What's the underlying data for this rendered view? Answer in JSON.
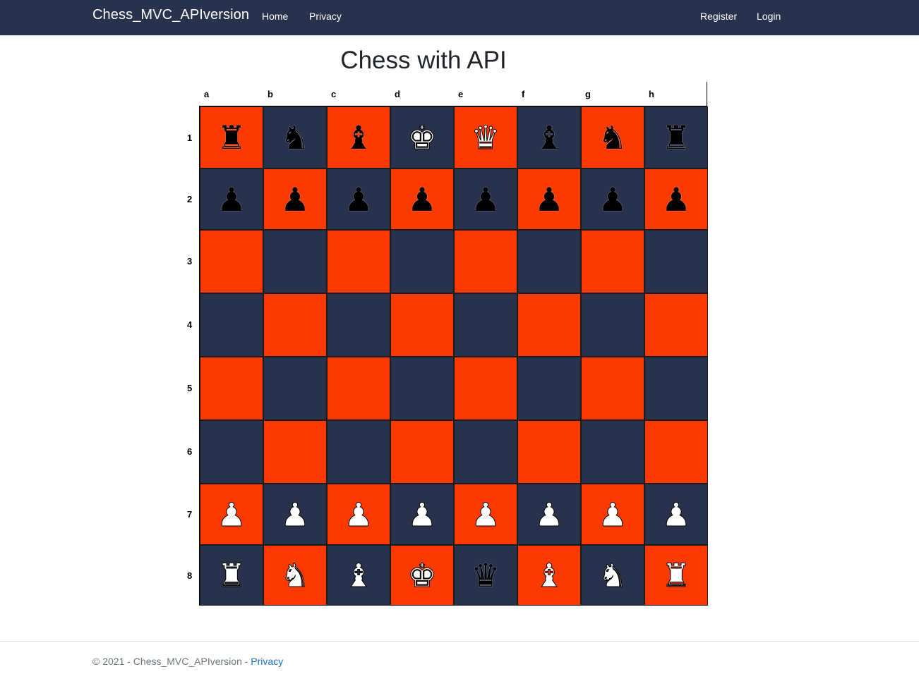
{
  "nav": {
    "brand": "Chess_MVC_APIversion",
    "home": "Home",
    "privacy": "Privacy",
    "register": "Register",
    "login": "Login"
  },
  "page_title": "Chess with API",
  "board": {
    "columns": [
      "a",
      "b",
      "c",
      "d",
      "e",
      "f",
      "g",
      "h"
    ],
    "rows": [
      "1",
      "2",
      "3",
      "4",
      "5",
      "6",
      "7",
      "8"
    ],
    "colors": {
      "light": "#fa3a00",
      "dark": "#29324d"
    },
    "pieces": [
      [
        "black-rook",
        "black-knight",
        "black-bishop",
        "white-king",
        "white-queen",
        "black-bishop",
        "black-knight",
        "black-rook"
      ],
      [
        "black-pawn",
        "black-pawn",
        "black-pawn",
        "black-pawn",
        "black-pawn",
        "black-pawn",
        "black-pawn",
        "black-pawn"
      ],
      [
        "",
        "",
        "",
        "",
        "",
        "",
        "",
        ""
      ],
      [
        "",
        "",
        "",
        "",
        "",
        "",
        "",
        ""
      ],
      [
        "",
        "",
        "",
        "",
        "",
        "",
        "",
        ""
      ],
      [
        "",
        "",
        "",
        "",
        "",
        "",
        "",
        ""
      ],
      [
        "white-pawn",
        "white-pawn",
        "white-pawn",
        "white-pawn",
        "white-pawn",
        "white-pawn",
        "white-pawn",
        "white-pawn"
      ],
      [
        "white-rook",
        "white-knight",
        "white-bishop",
        "white-king",
        "black-queen",
        "white-bishop",
        "white-knight",
        "white-rook"
      ]
    ]
  },
  "footer": {
    "text": "© 2021 - Chess_MVC_APIversion - ",
    "privacy_link": "Privacy"
  }
}
